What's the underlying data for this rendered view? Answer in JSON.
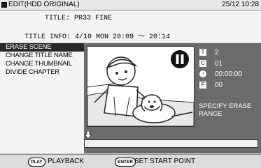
{
  "header": {
    "title": "EDIT(HDD ORIGINAL)",
    "datetime": "25/12 10:28"
  },
  "info": {
    "title_line": "TITLE: PR33 FINE",
    "title_info_line": "TITLE INFO: 4/10 MON 20:09 ～ 20:14"
  },
  "menu": {
    "items": [
      {
        "label": "ERASE SCENE"
      },
      {
        "label": "CHANGE TITLE NAME"
      },
      {
        "label": "CHANGE THUMBNAIL"
      },
      {
        "label": "DIVIDE CHAPTER"
      }
    ]
  },
  "stats": {
    "title_no": {
      "icon": "T",
      "value": "2"
    },
    "chapter_no": {
      "icon": "C",
      "value": "01"
    },
    "time": {
      "icon": "clock-icon",
      "value": "00:00:00"
    },
    "frame": {
      "icon": "F",
      "value": "00"
    }
  },
  "message": "SPECIFY ERASE RANGE",
  "footer": {
    "play_button": "PLAY",
    "play_label": "PLAYBACK",
    "enter_button": "ENTER",
    "enter_label": "SET START POINT"
  }
}
